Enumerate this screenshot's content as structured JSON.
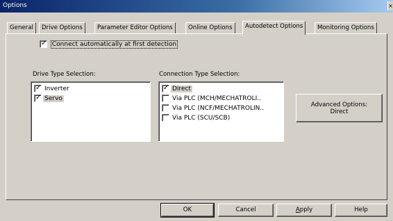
{
  "window": {
    "title": "Options",
    "close_glyph": "×"
  },
  "tabs": [
    {
      "label": "General",
      "active": false
    },
    {
      "label": "Drive Options",
      "active": false
    },
    {
      "label": "Parameter Editor Options",
      "active": false
    },
    {
      "label": "Online Options",
      "active": false
    },
    {
      "label": "Autodetect Options",
      "active": true
    },
    {
      "label": "Monitoring Options",
      "active": false
    }
  ],
  "autodetect": {
    "connect_auto": {
      "label": "Connect automatically at first detection",
      "checked": true
    }
  },
  "drive_type": {
    "label": "Drive Type Selection:",
    "items": [
      {
        "label": "Inverter",
        "checked": true
      },
      {
        "label": "Servo",
        "checked": true
      }
    ]
  },
  "connection_type": {
    "label": "Connection Type Selection:",
    "items": [
      {
        "label": "Direct",
        "checked": true
      },
      {
        "label": "Via PLC (MCH/MECHATROLI..",
        "checked": false
      },
      {
        "label": "Via PLC (NCF/MECHATROLIN..",
        "checked": false
      },
      {
        "label": "Via PLC (SCU/SCB)",
        "checked": false
      }
    ]
  },
  "advanced_button": {
    "line1": "Advanced Options:",
    "line2": "Direct"
  },
  "footer": {
    "ok": "OK",
    "cancel": "Cancel",
    "apply_prefix": "A",
    "apply_rest": "pply",
    "help": "Help"
  },
  "colors": {
    "face": "#d4d0c8",
    "title_start": "#0a246a",
    "title_end": "#a6caf0"
  },
  "icons": {
    "check": "check-mark",
    "close": "close-icon"
  }
}
